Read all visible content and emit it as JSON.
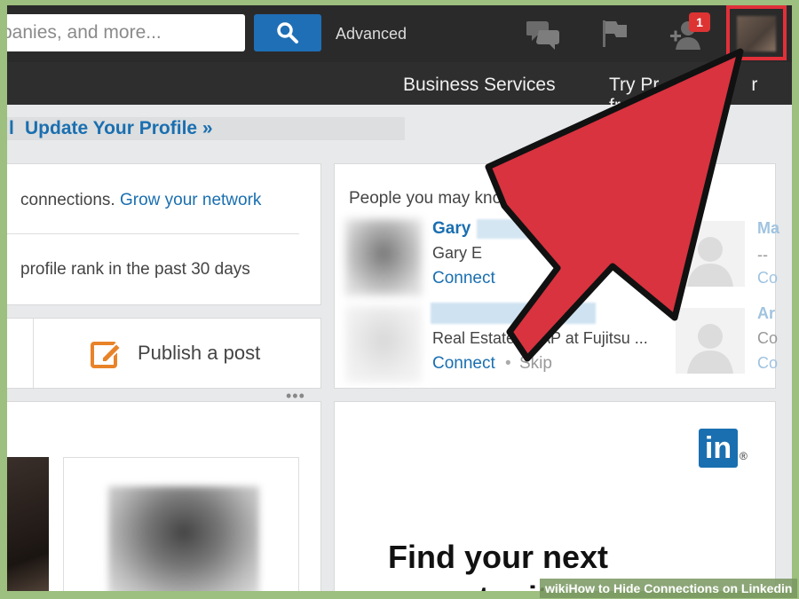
{
  "topbar": {
    "search_placeholder": "panies, and more...",
    "advanced_label": "Advanced",
    "notification_count": "1",
    "icons": [
      "search-icon",
      "messages-icon",
      "flag-icon",
      "add-connection-icon"
    ]
  },
  "navbar": {
    "items": [
      "Business Services",
      "Try Premium for free"
    ],
    "visible_items": [
      "Business Services",
      "Try Pr",
      "r free"
    ]
  },
  "profile": {
    "update_pipe": "l",
    "update_link": "Update Your Profile »"
  },
  "connections_card": {
    "line1_text": "connections. ",
    "grow_link": "Grow your network",
    "line2_text": "profile rank in the past 30 days"
  },
  "publish": {
    "label": "Publish a post",
    "icon": "edit-icon"
  },
  "pymk": {
    "title": "People you may know",
    "person1": {
      "name": "Gary",
      "headline": "Gary E",
      "connect": "Connect"
    },
    "person2": {
      "headline": "Real Estate - SAP at Fujitsu ...",
      "connect": "Connect",
      "separator": "•",
      "skip": "Skip"
    },
    "right_col": [
      "Ma",
      "--",
      "Co",
      "Ar",
      "Co",
      "Co"
    ]
  },
  "ad": {
    "logo": "in",
    "registered": "®",
    "headline_line1": "Find your next",
    "headline_line2": "opportunity"
  },
  "caption": {
    "text": "wikiHow to Hide Connections on Linkedin"
  },
  "colors": {
    "accent_red": "#e0303a",
    "linkedin_blue": "#1a6fb0",
    "dark_bar": "#2a2a2a"
  }
}
